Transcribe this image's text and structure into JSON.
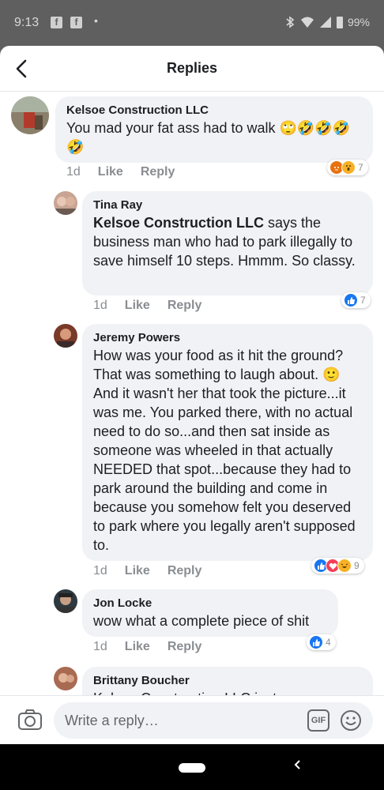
{
  "status_bar": {
    "time": "9:13",
    "fb1": "f",
    "fb2": "f",
    "dot": "•",
    "battery": "99%"
  },
  "header": {
    "title": "Replies"
  },
  "comments": [
    {
      "author": "Kelsoe Construction LLC",
      "text": "You mad your fat ass had to walk 🙄🤣🤣🤣🤣",
      "time": "1d",
      "like": "Like",
      "reply": "Reply",
      "reactions": [
        "angry",
        "wow"
      ],
      "count": "7"
    },
    {
      "author": "Tina Ray",
      "mention": "Kelsoe Construction LLC",
      "text": " says the business man who had to park illegally to save himself 10 steps. Hmmm. So classy.",
      "time": "1d",
      "like": "Like",
      "reply": "Reply",
      "reactions": [
        "like"
      ],
      "count": "7"
    },
    {
      "author": "Jeremy Powers",
      "text": "How was your food as it hit the ground? That was something to laugh about. 🙂 And it wasn't her that took the picture...it was me. You parked there, with no actual need to do so...and then sat inside as someone was wheeled in that actually NEEDED that spot...because they had to park around the building and come in because you somehow felt you deserved to park where you legally aren't supposed to.",
      "time": "1d",
      "like": "Like",
      "reply": "Reply",
      "reactions": [
        "like",
        "love",
        "haha"
      ],
      "count": "9"
    },
    {
      "author": "Jon Locke",
      "text": "wow what a complete piece of shit",
      "time": "1d",
      "like": "Like",
      "reply": "Reply",
      "reactions": [
        "like"
      ],
      "count": "4"
    },
    {
      "author": "Brittany Boucher",
      "text": "Kelsoe Construction LLC just"
    }
  ],
  "composer": {
    "placeholder": "Write a reply…",
    "gif_label": "GIF"
  },
  "colors": {
    "bubble": "#f0f2f5",
    "like_blue": "#1877f2",
    "love_red": "#f33e58",
    "haha_yellow": "#f7b125",
    "angry_orange": "#e9710f"
  }
}
